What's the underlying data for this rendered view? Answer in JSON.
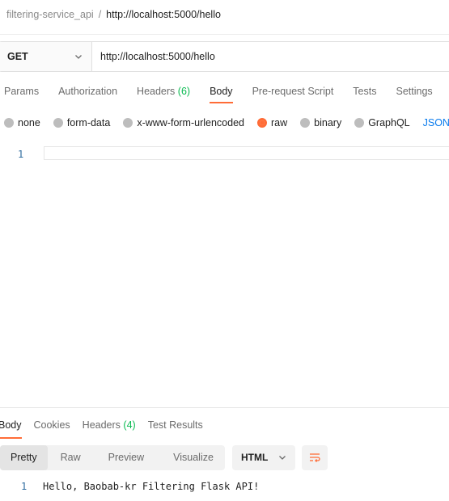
{
  "breadcrumb": {
    "collection": "filtering-service_api",
    "separator": "/",
    "request": "http://localhost:5000/hello"
  },
  "url_bar": {
    "method": "GET",
    "url": "http://localhost:5000/hello"
  },
  "request_tabs": {
    "params": "Params",
    "authorization": "Authorization",
    "headers": "Headers",
    "headers_count": "(6)",
    "body": "Body",
    "prerequest": "Pre-request Script",
    "tests": "Tests",
    "settings": "Settings",
    "active": "Body"
  },
  "body_types": {
    "none": "none",
    "form_data": "form-data",
    "urlencoded": "x-www-form-urlencoded",
    "raw": "raw",
    "binary": "binary",
    "graphql": "GraphQL",
    "json": "JSON",
    "selected": "raw"
  },
  "request_editor": {
    "line_number": "1",
    "content": ""
  },
  "response_tabs": {
    "body": "Body",
    "cookies": "Cookies",
    "headers": "Headers",
    "headers_count": "(4)",
    "test_results": "Test Results",
    "active": "Body"
  },
  "response_toolbar": {
    "pretty": "Pretty",
    "raw": "Raw",
    "preview": "Preview",
    "visualize": "Visualize",
    "active_view": "Pretty",
    "format": "HTML"
  },
  "response_body": {
    "line_number": "1",
    "text": "Hello, Baobab-kr Filtering Flask API!"
  },
  "colors": {
    "accent": "#ff6c37",
    "count_green": "#0cbb52",
    "line_number_blue": "#2d6b9e",
    "link_blue": "#097bed"
  },
  "icons": {
    "method_dropdown": "chevron-down-icon",
    "format_dropdown": "chevron-down-icon",
    "wrap_lines": "wrap-lines-icon"
  }
}
